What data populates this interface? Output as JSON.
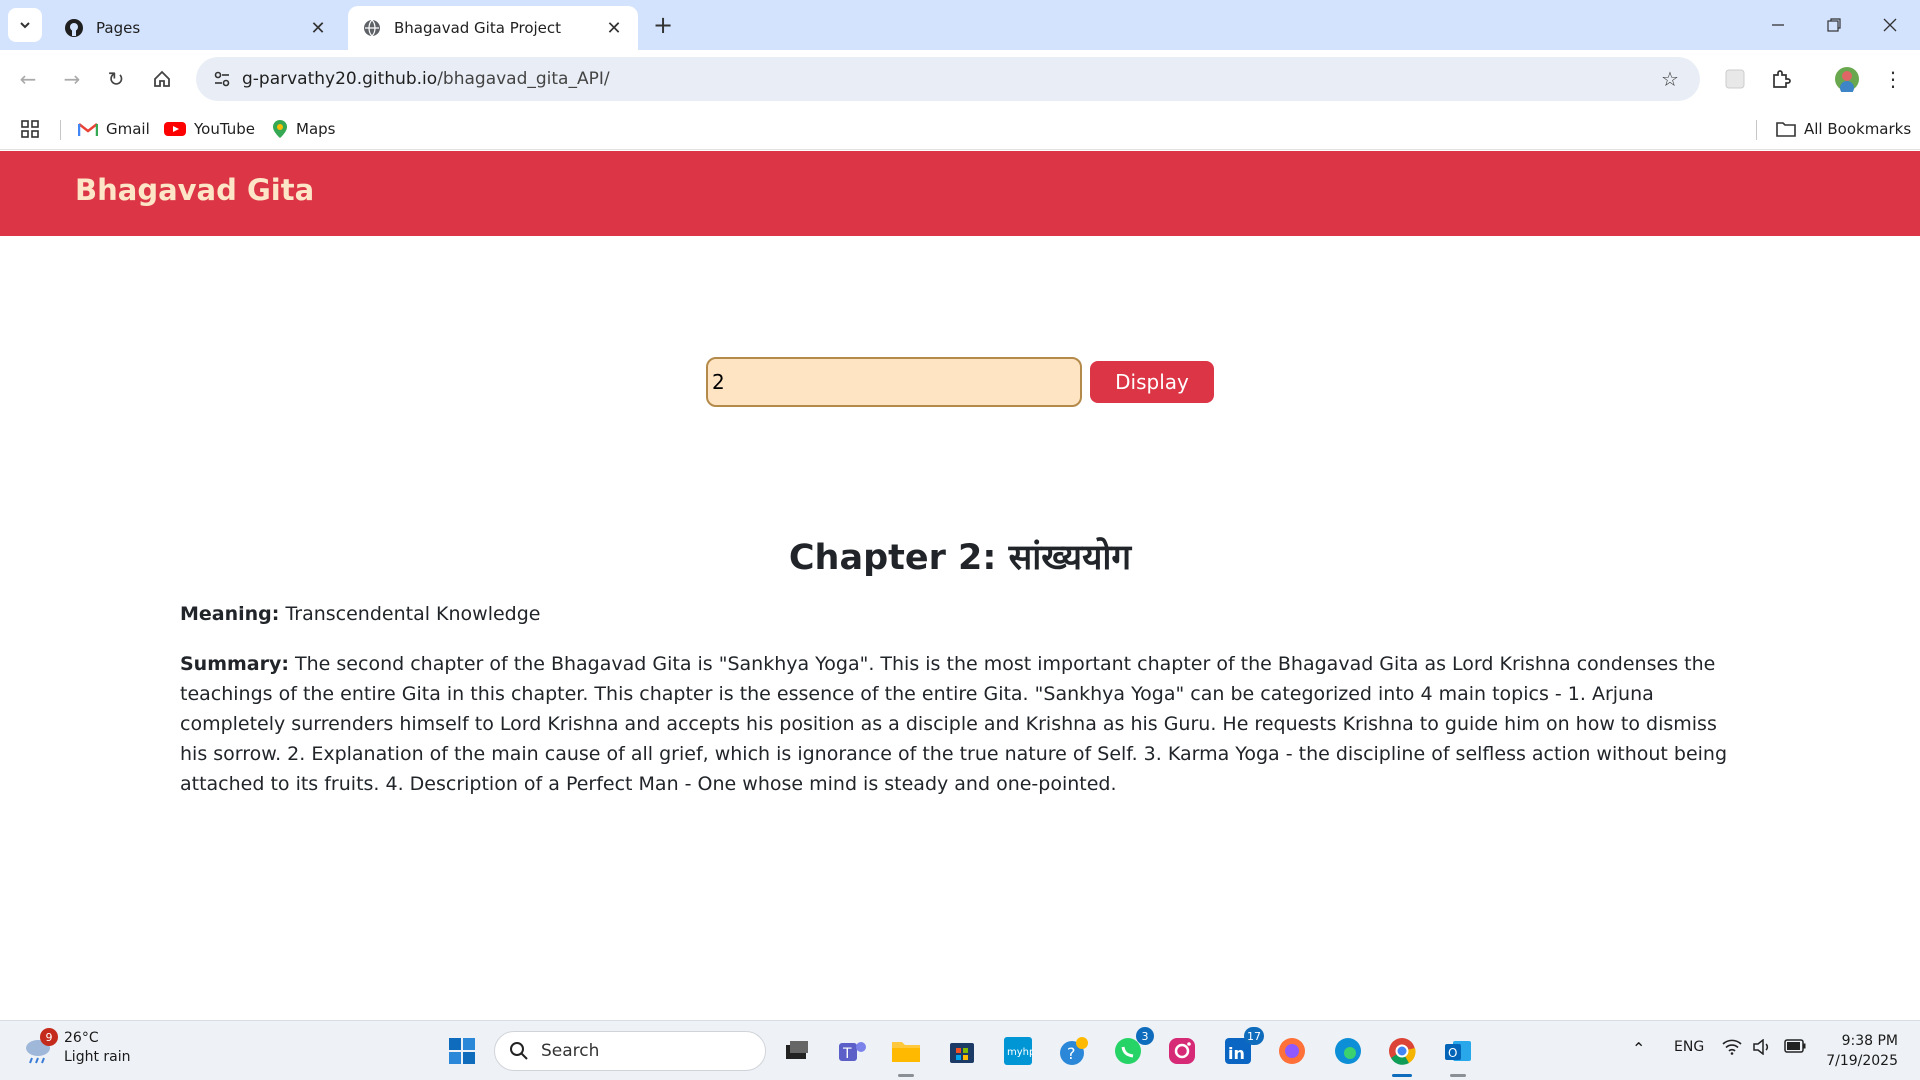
{
  "browser": {
    "tabs": [
      {
        "title": "Pages",
        "active": false
      },
      {
        "title": "Bhagavad Gita Project",
        "active": true
      }
    ],
    "url_host": "g-parvathy20.github.io",
    "url_path": "/bhagavad_gita_API/",
    "bookmarks": [
      {
        "label": "Gmail"
      },
      {
        "label": "YouTube"
      },
      {
        "label": "Maps"
      }
    ],
    "all_bookmarks": "All Bookmarks"
  },
  "page": {
    "brand": "Bhagavad Gita",
    "chapter_input_value": "2",
    "display_button": "Display",
    "chapter_title": "Chapter 2: सांख्ययोग",
    "meaning_label": "Meaning:",
    "meaning_text": "Transcendental Knowledge",
    "summary_label": "Summary:",
    "summary_text": "The second chapter of the Bhagavad Gita is \"Sankhya Yoga\". This is the most important chapter of the Bhagavad Gita as Lord Krishna condenses the teachings of the entire Gita in this chapter. This chapter is the essence of the entire Gita. \"Sankhya Yoga\" can be categorized into 4 main topics - 1. Arjuna completely surrenders himself to Lord Krishna and accepts his position as a disciple and Krishna as his Guru. He requests Krishna to guide him on how to dismiss his sorrow. 2. Explanation of the main cause of all grief, which is ignorance of the true nature of Self. 3. Karma Yoga - the discipline of selfless action without being attached to its fruits. 4. Description of a Perfect Man - One whose mind is steady and one-pointed."
  },
  "taskbar": {
    "weather_temp": "26°C",
    "weather_desc": "Light rain",
    "weather_badge": "9",
    "search_label": "Search",
    "teams_badge": "3",
    "linkedin_badge": "17",
    "lang": "ENG",
    "time": "9:38 PM",
    "date": "7/19/2025"
  },
  "colors": {
    "navbar": "#dc3545",
    "brand_text": "#fde6c8",
    "input_bg": "#ffe4c4",
    "button_bg": "#dc3545"
  }
}
